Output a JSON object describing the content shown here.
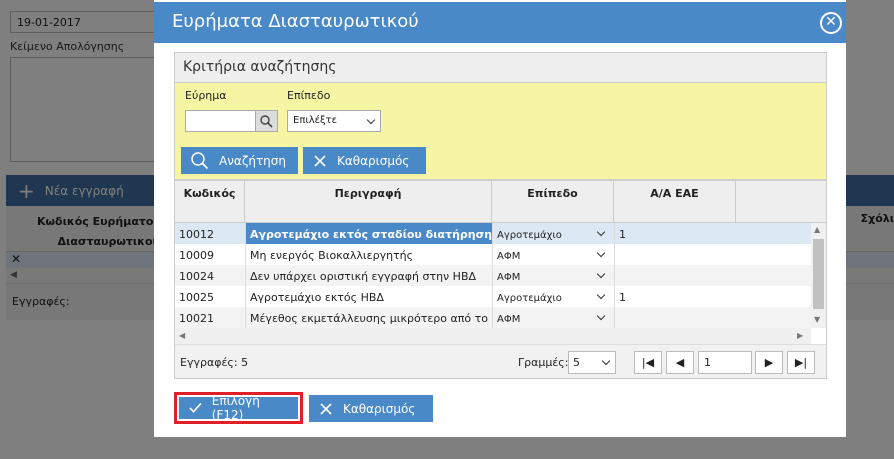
{
  "background": {
    "date_value": "19-01-2017",
    "textarea_label": "Κείμενο Απολόγησης",
    "new_record_label": "Νέα εγγραφή",
    "col_code_title": "Κωδικός Ευρήματος Διασταυρωτικού",
    "col_right_title": "Σχόλι",
    "records_label": "Εγγραφές:",
    "toolbar_color": "#3f6fa0"
  },
  "dialog": {
    "title": "Ευρήματα Διασταυρωτικού",
    "close_icon": "close-icon",
    "header_color": "#4a89c8",
    "criteria": {
      "title": "Κριτήρια αναζήτησης",
      "finding_label": "Εύρημα",
      "finding_value": "",
      "level_label": "Επίπεδο",
      "level_selected": "Επιλέξτε",
      "search_button": "Αναζήτηση",
      "clear_button": "Καθαρισμός",
      "panel_color": "#f5f5a4"
    },
    "grid": {
      "headers": [
        "Κωδικός",
        "Περιγραφή",
        "Επίπεδο",
        "Α/Α ΕΑΕ"
      ],
      "rows": [
        {
          "code": "10012",
          "description": "Αγροτεμάχιο εκτός σταδίου διατήρησης",
          "level": "Αγροτεμάχιο",
          "aa": "1",
          "selected": true
        },
        {
          "code": "10009",
          "description": "Μη ενεργός Βιοκαλλιεργητής",
          "level": "ΑΦΜ",
          "aa": "",
          "selected": false
        },
        {
          "code": "10024",
          "description": "Δεν υπάρχει οριστική εγγραφή στην ΗΒΔ",
          "level": "ΑΦΜ",
          "aa": "",
          "selected": false
        },
        {
          "code": "10025",
          "description": "Αγροτεμάχιο εκτός ΗΒΔ",
          "level": "Αγροτεμάχιο",
          "aa": "1",
          "selected": false
        },
        {
          "code": "10021",
          "description": "Μέγεθος εκμετάλλευσης μικρότερο από το",
          "level": "ΑΦΜ",
          "aa": "",
          "selected": false
        }
      ],
      "records_label": "Εγγραφές: 5",
      "rows_label": "Γραμμές:",
      "rows_per_page": "5",
      "current_page": "1"
    },
    "select_button": "Επιλογή (F12)",
    "clear_button": "Καθαρισμός",
    "highlight_color": "#e02027"
  }
}
